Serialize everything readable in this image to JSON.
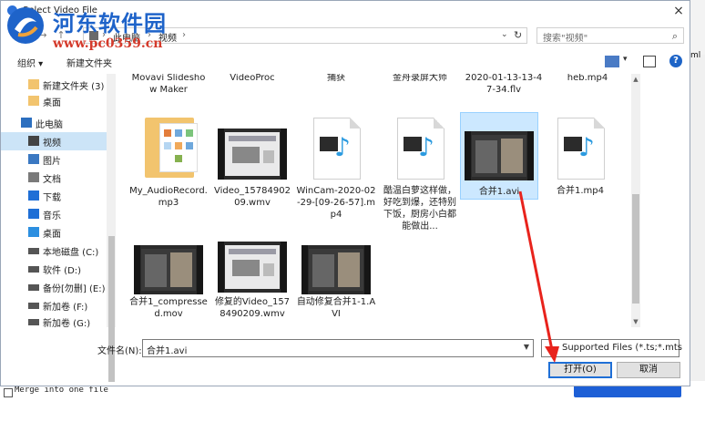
{
  "dialog": {
    "title": "Select Video File",
    "close_label": "×"
  },
  "watermark": {
    "title": "河东软件园",
    "url": "www.pc0359.cn"
  },
  "navbar": {
    "back": "←",
    "forward": "→",
    "up": "↑",
    "crumbs": [
      "此电脑",
      "视频"
    ],
    "separator": "›",
    "dropdown": "⌄",
    "refresh": "↻",
    "search_placeholder": "搜索\"视频\"",
    "search_icon": "⌕"
  },
  "toolbar": {
    "organize": "组织 ▾",
    "new_folder": "新建文件夹",
    "view_dd": "▾",
    "help": "?"
  },
  "sidebar": {
    "items": [
      {
        "label": "新建文件夹 (3)",
        "icon": "folder-icon",
        "color": "#f2c46e"
      },
      {
        "label": "桌面",
        "icon": "folder-icon",
        "color": "#f2c46e"
      },
      {
        "label": "此电脑",
        "icon": "computer-icon",
        "color": "#2c6fbf"
      },
      {
        "label": "视频",
        "icon": "video-icon",
        "color": "#444"
      },
      {
        "label": "图片",
        "icon": "picture-icon",
        "color": "#3a78c2"
      },
      {
        "label": "文档",
        "icon": "document-icon",
        "color": "#7a7a7a"
      },
      {
        "label": "下载",
        "icon": "download-icon",
        "color": "#1f6fd6"
      },
      {
        "label": "音乐",
        "icon": "music-icon",
        "color": "#1f6fd6"
      },
      {
        "label": "桌面",
        "icon": "desktop-icon",
        "color": "#2c8fe0"
      },
      {
        "label": "本地磁盘 (C:)",
        "icon": "drive-icon",
        "color": "#555"
      },
      {
        "label": "软件 (D:)",
        "icon": "drive-icon",
        "color": "#555"
      },
      {
        "label": "备份[勿删] (E:)",
        "icon": "drive-icon",
        "color": "#555"
      },
      {
        "label": "新加卷 (F:)",
        "icon": "drive-icon",
        "color": "#555"
      },
      {
        "label": "新加卷 (G:)",
        "icon": "drive-icon",
        "color": "#555"
      }
    ],
    "selected_index": 3
  },
  "files": {
    "row0": [
      "Movavi Slideshow Maker",
      "VideoProc",
      "捕获",
      "金舟录屏大师",
      "2020-01-13-13-47-34.flv",
      "heb.mp4"
    ],
    "row1": [
      {
        "name": "My_AudioRecord.mp3",
        "type": "folder-audio"
      },
      {
        "name": "Video_1578490209.wmv",
        "type": "video"
      },
      {
        "name": "WinCam-2020-02-29-[09-26-57].mp4",
        "type": "media"
      },
      {
        "name": "酷温白萝这样做，好吃到爆，还特别下饭，厨房小白都能做出...",
        "type": "media"
      },
      {
        "name": "合并1.avi",
        "type": "video-selected"
      },
      {
        "name": "合并1.mp4",
        "type": "media"
      }
    ],
    "row2": [
      {
        "name": "合并1_compressed.mov",
        "type": "video"
      },
      {
        "name": "修复的Video_1578490209.wmv",
        "type": "video"
      },
      {
        "name": "自动修复合并1-1.AVI",
        "type": "video"
      }
    ]
  },
  "footer": {
    "filename_label": "文件名(N):",
    "filename_value": "合并1.avi",
    "filetype_value": "Supported Files (*.ts;*.mts",
    "open_label": "打开(O)",
    "cancel_label": "取消"
  },
  "background": {
    "merge_label": "Merge into one file",
    "ml_label": "ml"
  },
  "colors": {
    "accent": "#1f6fd6",
    "selection": "#cce8ff",
    "arrow": "#e8231c"
  }
}
